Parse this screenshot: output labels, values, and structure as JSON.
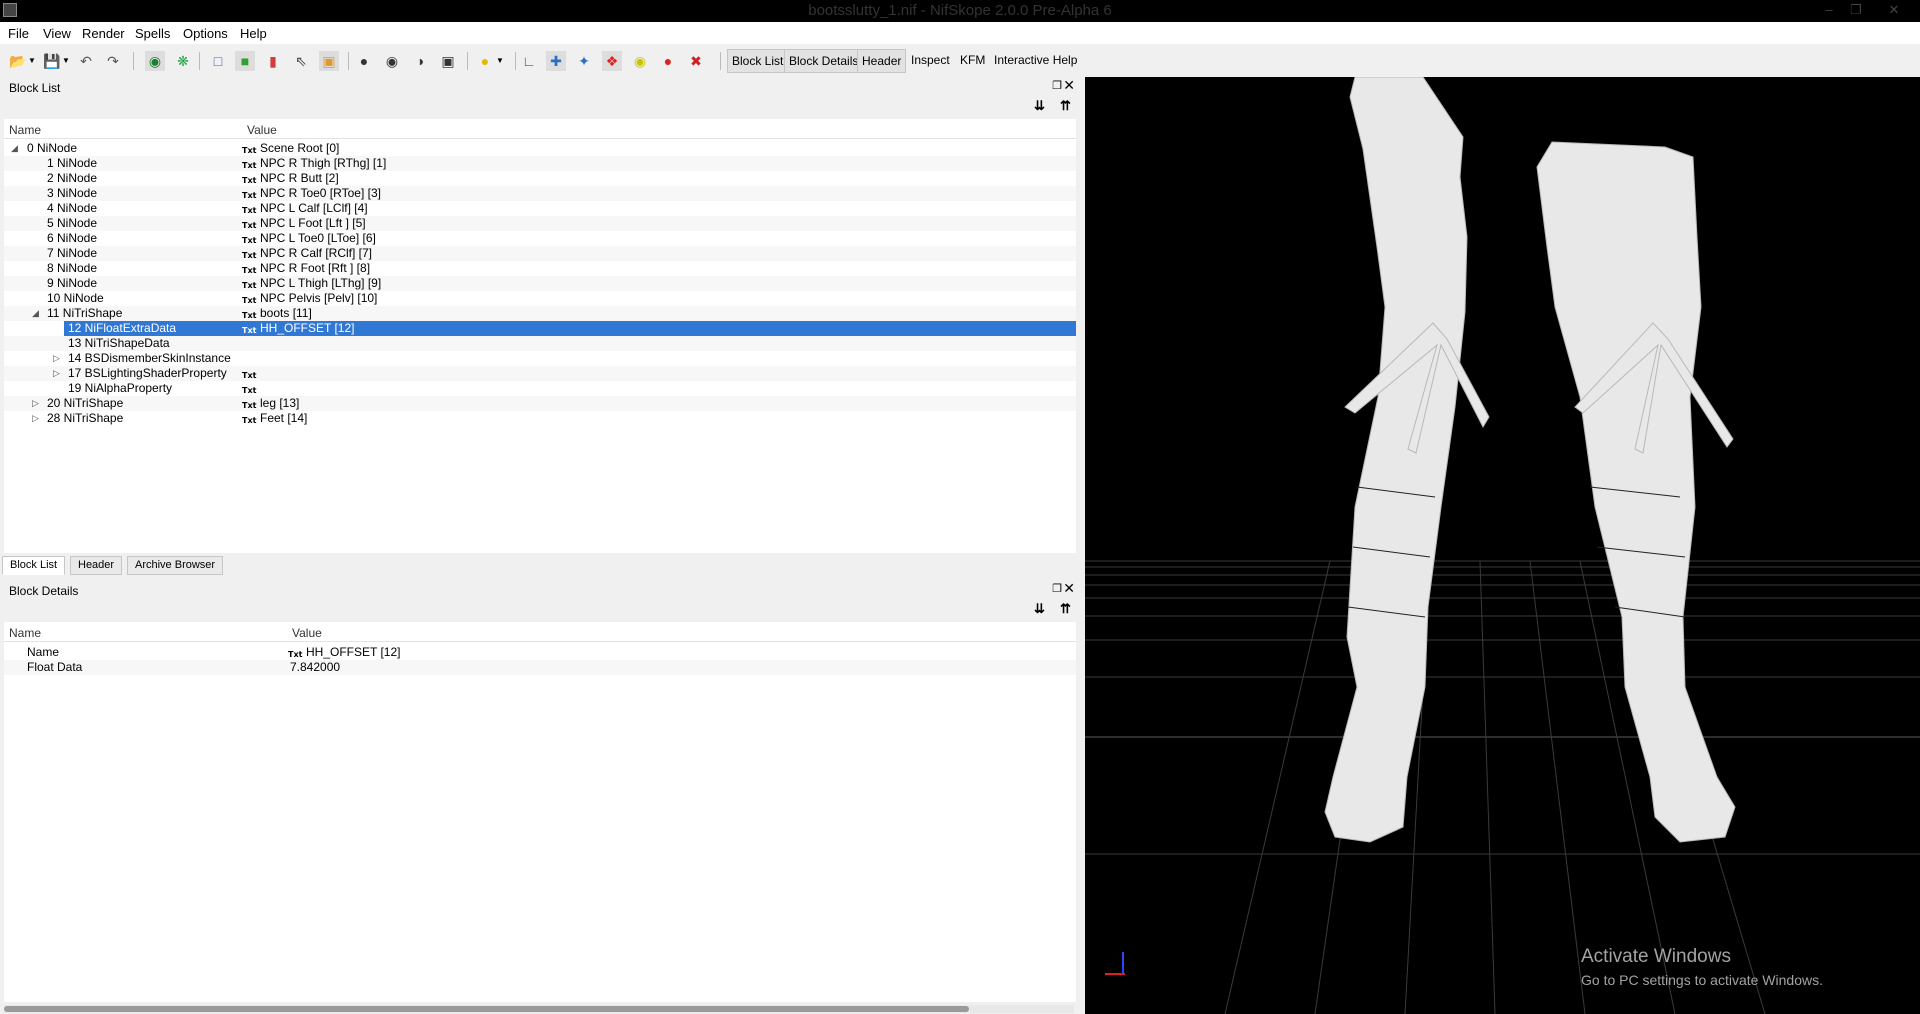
{
  "window": {
    "title": "bootsslutty_1.nif - NifSkope 2.0.0 Pre-Alpha 6"
  },
  "menu": [
    "File",
    "View",
    "Render",
    "Spells",
    "Options",
    "Help"
  ],
  "toolbar": {
    "buttons": [
      "Block List",
      "Block Details",
      "Header",
      "Inspect",
      "KFM",
      "Interactive Help"
    ]
  },
  "block_list": {
    "title": "Block List",
    "col_name": "Name",
    "col_value": "Value",
    "rows": [
      {
        "name": "0 NiNode",
        "value": "Scene Root [0]",
        "txt": "Txt"
      },
      {
        "name": "1 NiNode",
        "value": "NPC R Thigh [RThg] [1]",
        "txt": "Txt"
      },
      {
        "name": "2 NiNode",
        "value": "NPC R Butt [2]",
        "txt": "Txt"
      },
      {
        "name": "3 NiNode",
        "value": "NPC R Toe0 [RToe] [3]",
        "txt": "Txt"
      },
      {
        "name": "4 NiNode",
        "value": "NPC L Calf [LClf] [4]",
        "txt": "Txt"
      },
      {
        "name": "5 NiNode",
        "value": "NPC L Foot [Lft ] [5]",
        "txt": "Txt"
      },
      {
        "name": "6 NiNode",
        "value": "NPC L Toe0 [LToe] [6]",
        "txt": "Txt"
      },
      {
        "name": "7 NiNode",
        "value": "NPC R Calf [RClf] [7]",
        "txt": "Txt"
      },
      {
        "name": "8 NiNode",
        "value": "NPC R Foot [Rft ] [8]",
        "txt": "Txt"
      },
      {
        "name": "9 NiNode",
        "value": "NPC L Thigh [LThg] [9]",
        "txt": "Txt"
      },
      {
        "name": "10 NiNode",
        "value": "NPC Pelvis [Pelv] [10]",
        "txt": "Txt"
      },
      {
        "name": "11 NiTriShape",
        "value": "boots [11]",
        "txt": "Txt"
      },
      {
        "name": "12 NiFloatExtraData",
        "value": "HH_OFFSET [12]",
        "txt": "Txt"
      },
      {
        "name": "13 NiTriShapeData",
        "value": "",
        "txt": ""
      },
      {
        "name": "14 BSDismemberSkinInstance",
        "value": "",
        "txt": ""
      },
      {
        "name": "17 BSLightingShaderProperty",
        "value": "",
        "txt": "Txt"
      },
      {
        "name": "19 NiAlphaProperty",
        "value": "",
        "txt": "Txt"
      },
      {
        "name": "20 NiTriShape",
        "value": "leg [13]",
        "txt": "Txt"
      },
      {
        "name": "28 NiTriShape",
        "value": "Feet [14]",
        "txt": "Txt"
      }
    ]
  },
  "tabs": [
    "Block List",
    "Header",
    "Archive Browser"
  ],
  "block_details": {
    "title": "Block Details",
    "col_name": "Name",
    "col_value": "Value",
    "rows": [
      {
        "name": "Name",
        "value": "HH_OFFSET [12]",
        "txt": "Txt"
      },
      {
        "name": "Float Data",
        "value": "7.842000",
        "txt": ""
      }
    ]
  },
  "watermark": {
    "line1": "Activate Windows",
    "line2": "Go to PC settings to activate Windows."
  }
}
